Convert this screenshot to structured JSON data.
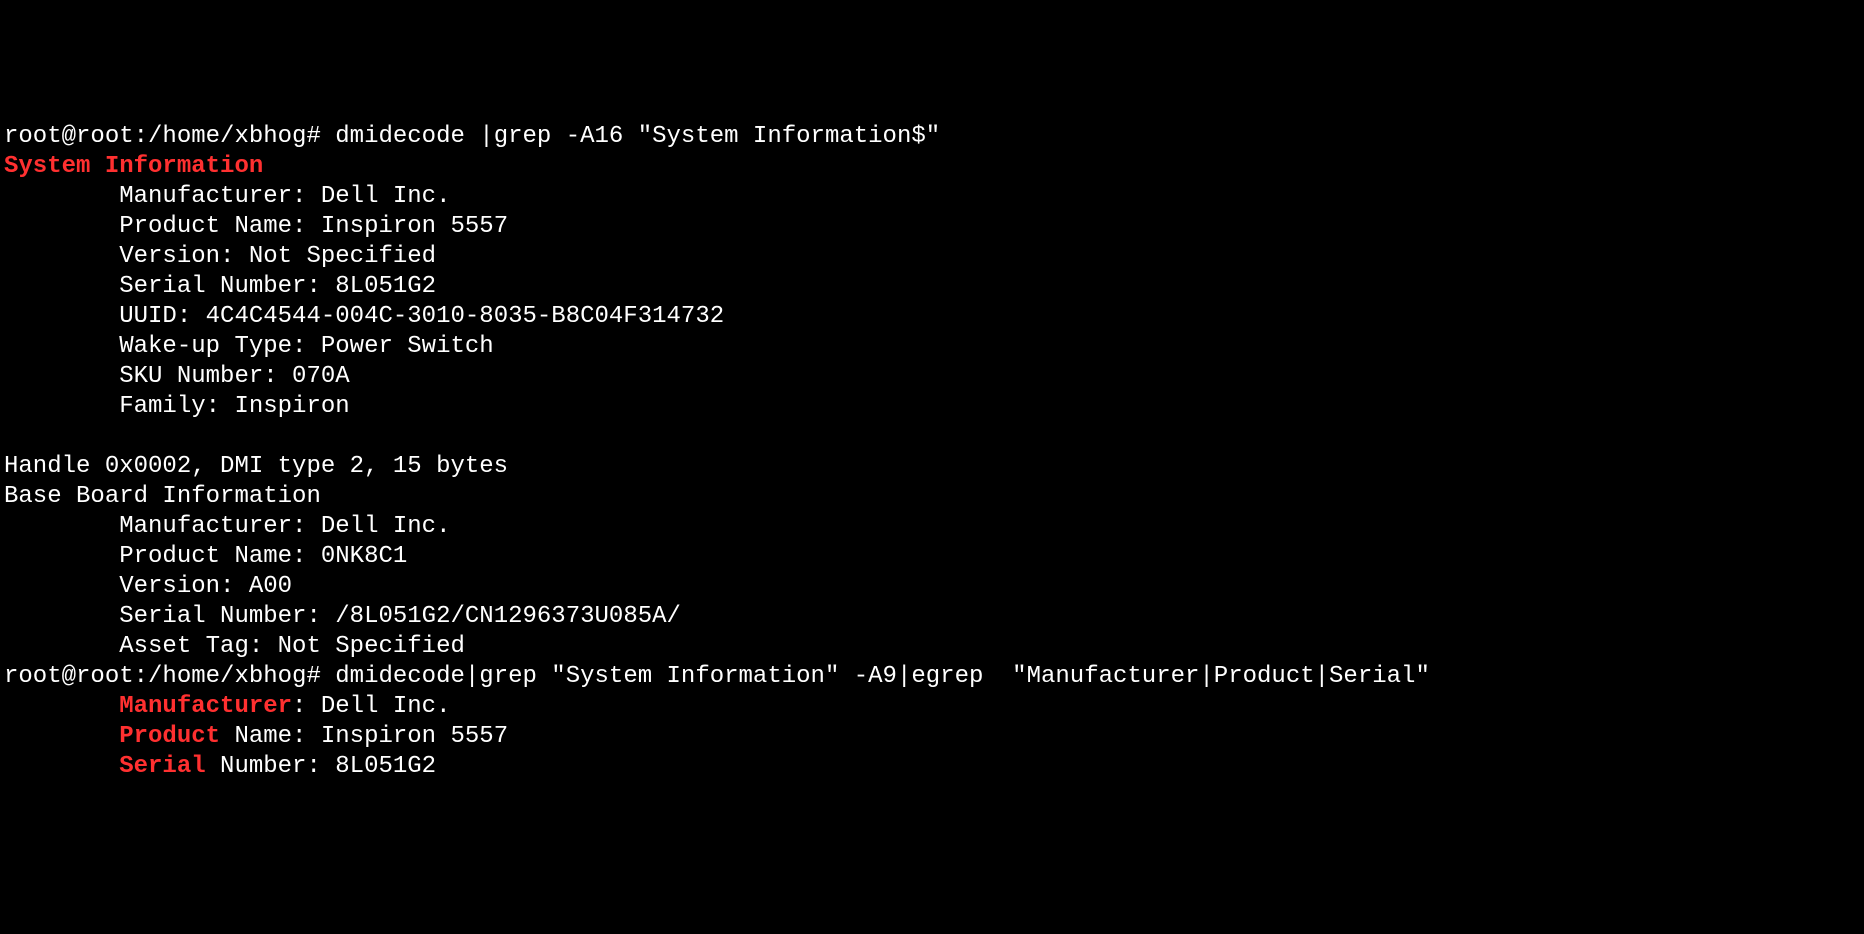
{
  "lines": {
    "prompt1_user": "root@root",
    "prompt1_path": ":/home/xbhog# ",
    "command1": "dmidecode |grep -A16 \"System Information$\"",
    "sysinfo_header": "System Information",
    "sys_manufacturer_label": "        Manufacturer: ",
    "sys_manufacturer_value": "Dell Inc.",
    "sys_product_label": "        Product Name: ",
    "sys_product_value": "Inspiron 5557",
    "sys_version_label": "        Version: ",
    "sys_version_value": "Not Specified",
    "sys_serial_label": "        Serial Number: ",
    "sys_serial_value": "8L051G2",
    "sys_uuid_label": "        UUID: ",
    "sys_uuid_value": "4C4C4544-004C-3010-8035-B8C04F314732",
    "sys_wakeup_label": "        Wake-up Type: ",
    "sys_wakeup_value": "Power Switch",
    "sys_sku_label": "        SKU Number: ",
    "sys_sku_value": "070A",
    "sys_family_label": "        Family: ",
    "sys_family_value": "Inspiron",
    "blank": "",
    "handle_line": "Handle 0x0002, DMI type 2, 15 bytes",
    "baseboard_header": "Base Board Information",
    "bb_manufacturer_label": "        Manufacturer: ",
    "bb_manufacturer_value": "Dell Inc.",
    "bb_product_label": "        Product Name: ",
    "bb_product_value": "0NK8C1",
    "bb_version_label": "        Version: ",
    "bb_version_value": "A00",
    "bb_serial_label": "        Serial Number: ",
    "bb_serial_value": "/8L051G2/CN1296373U085A/",
    "bb_asset_label": "        Asset Tag: ",
    "bb_asset_value": "Not Specified",
    "prompt2_user": "root@root",
    "prompt2_path": ":/home/xbhog# ",
    "command2": "dmidecode|grep \"System Information\" -A9|egrep  \"Manufacturer|Product|Serial\"",
    "out2_pre1": "        ",
    "out2_red1": "Manufacturer",
    "out2_post1": ": Dell Inc.",
    "out2_pre2": "        ",
    "out2_red2": "Product",
    "out2_post2": " Name: Inspiron 5557",
    "out2_pre3": "        ",
    "out2_red3": "Serial",
    "out2_post3": " Number: 8L051G2"
  }
}
